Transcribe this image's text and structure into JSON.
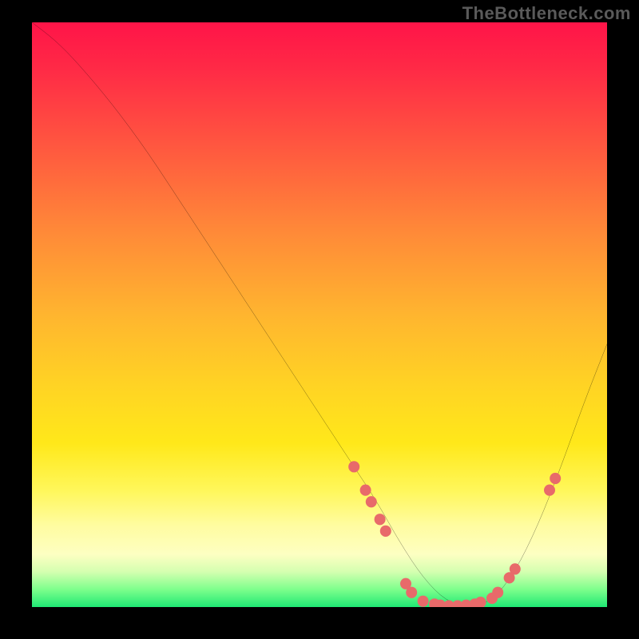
{
  "watermark": "TheBottleneck.com",
  "chart_data": {
    "type": "line",
    "title": "",
    "xlabel": "",
    "ylabel": "",
    "xlim": [
      0,
      100
    ],
    "ylim": [
      0,
      100
    ],
    "series": [
      {
        "name": "curve",
        "x": [
          0,
          4,
          8,
          14,
          20,
          26,
          32,
          38,
          44,
          50,
          56,
          60,
          64,
          68,
          72,
          76,
          80,
          84,
          88,
          92,
          96,
          100
        ],
        "y": [
          100,
          97,
          93,
          86,
          78,
          69,
          60,
          51,
          42,
          33,
          24,
          18,
          11,
          5,
          1,
          0,
          1,
          6,
          14,
          24,
          35,
          45
        ]
      }
    ],
    "markers": {
      "name": "highlight-dots",
      "color": "#e86a6a",
      "radius": 7,
      "points": [
        {
          "x": 56,
          "y": 24
        },
        {
          "x": 58,
          "y": 20
        },
        {
          "x": 59,
          "y": 18
        },
        {
          "x": 60.5,
          "y": 15
        },
        {
          "x": 61.5,
          "y": 13
        },
        {
          "x": 65,
          "y": 4
        },
        {
          "x": 66,
          "y": 2.5
        },
        {
          "x": 68,
          "y": 1
        },
        {
          "x": 70,
          "y": 0.5
        },
        {
          "x": 71,
          "y": 0.3
        },
        {
          "x": 72.5,
          "y": 0.2
        },
        {
          "x": 74,
          "y": 0.2
        },
        {
          "x": 75.5,
          "y": 0.3
        },
        {
          "x": 77,
          "y": 0.5
        },
        {
          "x": 78,
          "y": 0.8
        },
        {
          "x": 80,
          "y": 1.5
        },
        {
          "x": 81,
          "y": 2.5
        },
        {
          "x": 83,
          "y": 5
        },
        {
          "x": 84,
          "y": 6.5
        },
        {
          "x": 90,
          "y": 20
        },
        {
          "x": 91,
          "y": 22
        }
      ]
    }
  }
}
